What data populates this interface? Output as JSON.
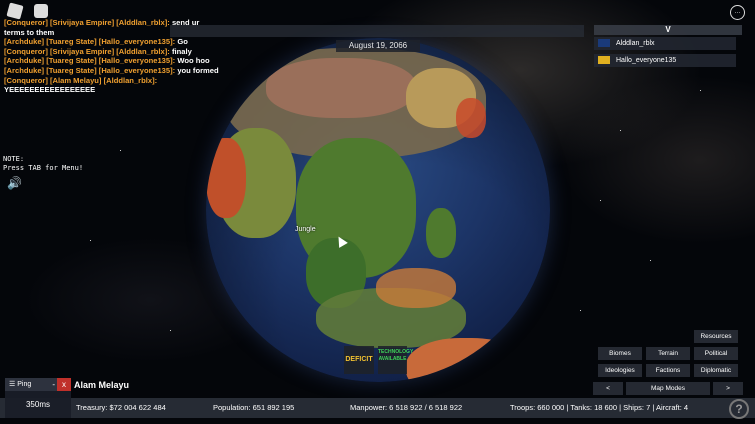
{
  "date": "August 19, 2066",
  "chat": [
    {
      "rank": "[Conqueror] [Srivijaya Empire] [Alddlan_rblx]:",
      "msg": "send ur terms to them"
    },
    {
      "rank": "[Archduke] [Tuareg State] [Hallo_everyone135]:",
      "msg": "Go"
    },
    {
      "rank": "[Conqueror] [Srivijaya Empire] [Alddlan_rblx]:",
      "msg": "finaly"
    },
    {
      "rank": "[Archduke] [Tuareg State] [Hallo_everyone135]:",
      "msg": "Woo hoo"
    },
    {
      "rank": "[Archduke] [Tuareg State] [Hallo_everyone135]:",
      "msg": "you formed"
    },
    {
      "rank": "[Conqueror] [Alam Melayu] [Alddlan_rblx]:",
      "msg": "YEEEEEEEEEEEEEEEEE"
    }
  ],
  "note": [
    "NOTE:",
    "Press TAB for Menu!"
  ],
  "players": {
    "header": "V",
    "rows": [
      {
        "name": "Alddlan_rblx",
        "flag_color": "#1a3a7a"
      },
      {
        "name": "Hallo_everyone135",
        "flag_color": "#e0b020"
      }
    ]
  },
  "map_label": "Jungle",
  "deficit": "DEFICIT",
  "technology": "TECHNOLOGY AVAILABLE",
  "map_buttons": {
    "resources": "Resources",
    "biomes": "Biomes",
    "terrain": "Terrain",
    "political": "Political",
    "ideologies": "Ideologies",
    "factions": "Factions",
    "diplomatic": "Diplomatic",
    "prev": "<",
    "map_modes": "Map Modes",
    "next": ">"
  },
  "nation_name": "Alam Melayu",
  "stats": {
    "treasury": "Treasury: $72 004 622 484",
    "population": "Population: 651 892 195",
    "manpower": "Manpower: 6 518 922 / 6 518 922",
    "military": "Troops: 660 000 | Tanks: 18 600 | Ships: 7 | Aircraft: 4"
  },
  "ping": {
    "title": "Ping",
    "min": "-",
    "close": "x",
    "value": "350ms"
  },
  "help": "?",
  "menu": "..."
}
